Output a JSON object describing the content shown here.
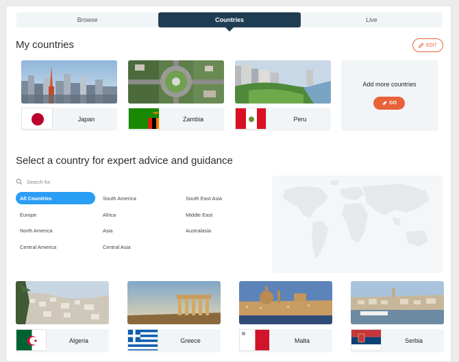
{
  "tabs": [
    {
      "label": "Browse",
      "active": false
    },
    {
      "label": "Countries",
      "active": true
    },
    {
      "label": "Live",
      "active": false
    }
  ],
  "my_countries": {
    "title": "My countries",
    "edit_label": "EDIT",
    "items": [
      {
        "name": "Japan"
      },
      {
        "name": "Zambia"
      },
      {
        "name": "Peru"
      }
    ],
    "add_more_text": "Add more countries",
    "go_label": "GO"
  },
  "select": {
    "title": "Select a country for expert advice and guidance",
    "search_placeholder": "Search for",
    "regions": [
      "All Countries",
      "South America",
      "South East Asia",
      "Europe",
      "Africa",
      "Middle East",
      "North America",
      "Asia",
      "Australasia",
      "Central America",
      "Central Asia"
    ],
    "active_region": "All Countries"
  },
  "countries": [
    {
      "name": "Algeria"
    },
    {
      "name": "Greece"
    },
    {
      "name": "Malta"
    },
    {
      "name": "Serbia"
    }
  ],
  "colors": {
    "navy": "#1e3d53",
    "accent_orange": "#e8633a",
    "active_blue": "#2a9df4",
    "panel_bg": "#f1f5f8"
  },
  "icons": {
    "edit": "pencil-icon",
    "go": "rocket-icon",
    "search": "search-icon"
  }
}
